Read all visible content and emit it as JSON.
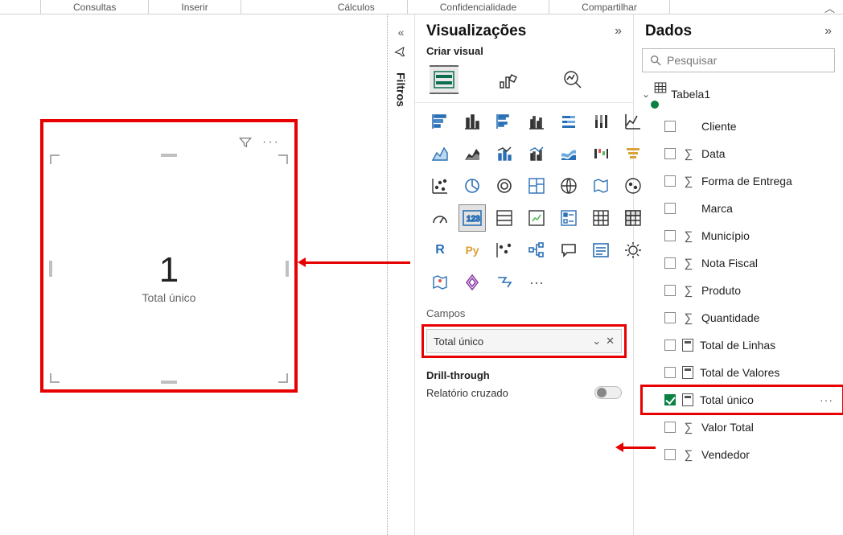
{
  "ribbon": {
    "groups": [
      "Consultas",
      "Inserir",
      "Cálculos",
      "Confidencialidade",
      "Compartilhar"
    ]
  },
  "card": {
    "value": "1",
    "label": "Total único"
  },
  "filters_pane": {
    "label": "Filtros"
  },
  "visualizations_pane": {
    "title": "Visualizações",
    "subtitle": "Criar visual",
    "fields_label": "Campos",
    "field_well_value": "Total único",
    "drill_label": "Drill-through",
    "cross_report_label": "Relatório cruzado",
    "cross_report_on": false
  },
  "data_pane": {
    "title": "Dados",
    "search_placeholder": "Pesquisar",
    "table": {
      "name": "Tabela1",
      "fields": [
        {
          "name": "Cliente",
          "icon": "none",
          "checked": false
        },
        {
          "name": "Data",
          "icon": "sigma",
          "checked": false
        },
        {
          "name": "Forma de Entrega",
          "icon": "sigma",
          "checked": false
        },
        {
          "name": "Marca",
          "icon": "none",
          "checked": false
        },
        {
          "name": "Município",
          "icon": "sigma",
          "checked": false
        },
        {
          "name": "Nota Fiscal",
          "icon": "sigma",
          "checked": false
        },
        {
          "name": "Produto",
          "icon": "sigma",
          "checked": false
        },
        {
          "name": "Quantidade",
          "icon": "sigma",
          "checked": false
        },
        {
          "name": "Total de Linhas",
          "icon": "calc",
          "checked": false
        },
        {
          "name": "Total de Valores",
          "icon": "calc",
          "checked": false
        },
        {
          "name": "Total único",
          "icon": "calc",
          "checked": true,
          "highlight": true,
          "show_more": true
        },
        {
          "name": "Valor Total",
          "icon": "sigma",
          "checked": false
        },
        {
          "name": "Vendedor",
          "icon": "sigma",
          "checked": false
        }
      ]
    }
  },
  "chart_data": {
    "type": "card",
    "title": "Total único",
    "value": 1
  }
}
